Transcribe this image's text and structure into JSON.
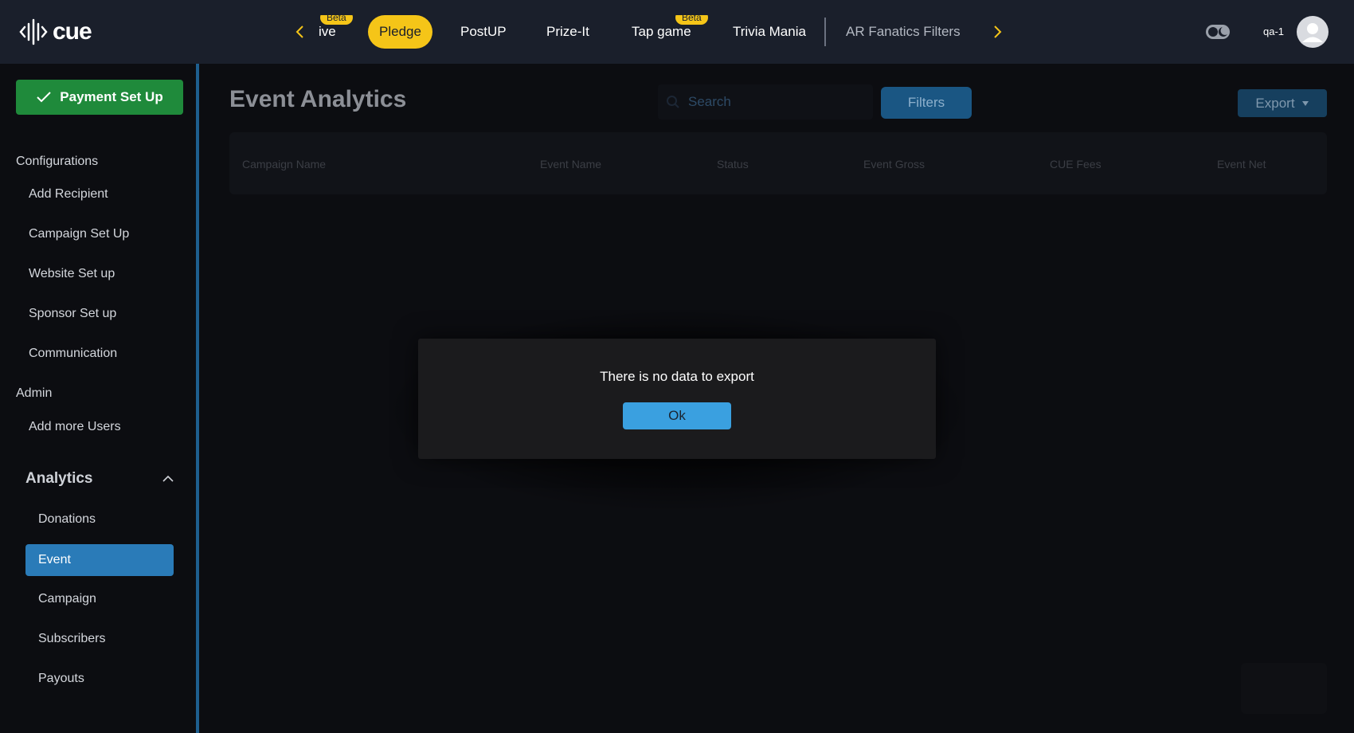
{
  "app": {
    "logo_text": "cue",
    "user": "qa-1"
  },
  "nav": {
    "tabs": [
      {
        "label": "ive",
        "beta": "Beta"
      },
      {
        "label": "Pledge"
      },
      {
        "label": "PostUP"
      },
      {
        "label": "Prize-It"
      },
      {
        "label": "Tap game",
        "beta": "Beta"
      },
      {
        "label": "Trivia Mania"
      },
      {
        "label": "AR Fanatics Filters"
      }
    ],
    "accent": "#f5c518"
  },
  "sidebar": {
    "payment_button": "Payment Set Up",
    "configurations_heading": "Configurations",
    "configurations": [
      "Add Recipient",
      "Campaign Set Up",
      "Website Set up",
      "Sponsor Set up",
      "Communication"
    ],
    "admin_heading": "Admin",
    "admin": [
      "Add more Users"
    ],
    "analytics_heading": "Analytics",
    "analytics": [
      "Donations",
      "Event",
      "Campaign",
      "Subscribers",
      "Payouts"
    ],
    "active_item": "Event"
  },
  "main": {
    "title": "Event Analytics",
    "search_placeholder": "Search",
    "filters_label": "Filters",
    "export_label": "Export",
    "columns": [
      "Campaign Name",
      "Event Name",
      "Status",
      "Event Gross",
      "CUE Fees",
      "Event Net"
    ]
  },
  "modal": {
    "message": "There is no data to export",
    "ok_label": "Ok"
  }
}
